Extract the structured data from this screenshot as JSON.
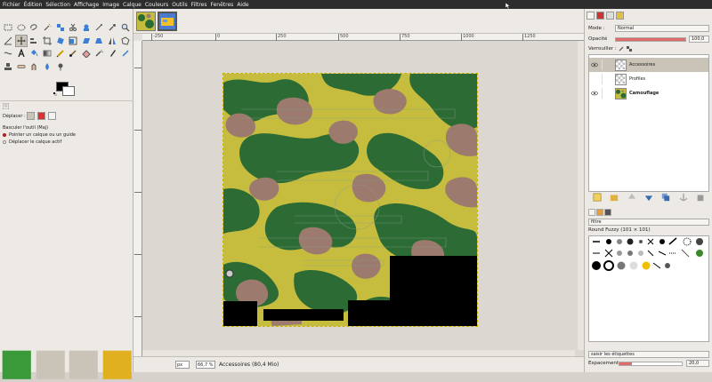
{
  "menubar": {
    "items": [
      "Fichier",
      "Édition",
      "Sélection",
      "Affichage",
      "Image",
      "Calque",
      "Couleurs",
      "Outils",
      "Filtres",
      "Fenêtres",
      "Aide"
    ]
  },
  "tool_options": {
    "tool_name": "Déplacer :",
    "toggle_label": "Basculer l'outil  (Maj)",
    "option1": "Pointer un calque ou un guide",
    "option2": "Déplacer le calque actif"
  },
  "ruler": {
    "ticks": [
      "-250",
      "0",
      "250",
      "500",
      "750",
      "1000",
      "1250"
    ]
  },
  "statusbar": {
    "unit": "px",
    "zoom": "66,7 %",
    "info": "Accessoires (80,4 Mio)"
  },
  "layers_panel": {
    "mode_label": "Mode :",
    "mode_value": "Normal",
    "opacity_label": "Opacité",
    "opacity_value": "100,0",
    "opacity_level": 1.0,
    "lock_label": "Verrouiller :",
    "layers": [
      {
        "name": "Accessoires",
        "selected": true,
        "visible": true
      },
      {
        "name": "Profiles",
        "selected": false,
        "visible": false
      },
      {
        "name": "Camouflage",
        "selected": false,
        "visible": true
      }
    ]
  },
  "brushes_panel": {
    "filter_placeholder": "filtre",
    "brush_name": "Round Fuzzy (101 × 101)",
    "tag_placeholder": "saisir les étiquettes",
    "spacing_label": "Espacement :",
    "spacing_value": "20,0",
    "spacing_level": 0.2
  },
  "colors": {
    "camo_yellow": "#c6bd3e",
    "camo_green": "#2c6b34",
    "camo_mauve": "#9c7a6e",
    "opacity_fill": "#e06a6a"
  }
}
